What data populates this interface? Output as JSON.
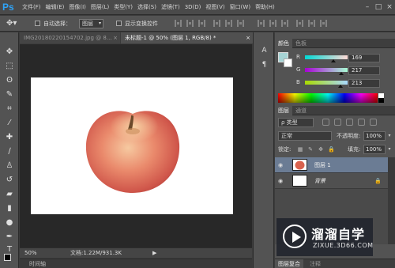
{
  "app": {
    "logo": "Ps"
  },
  "menu": [
    "文件(F)",
    "编辑(E)",
    "图像(I)",
    "图层(L)",
    "类型(Y)",
    "选择(S)",
    "滤镜(T)",
    "3D(D)",
    "视图(V)",
    "窗口(W)",
    "帮助(H)"
  ],
  "window_controls": {
    "minimize": "–",
    "maximize": "□",
    "close": "×"
  },
  "options": {
    "tool_icon": "move-tool",
    "auto_select_label": "自动选择：",
    "auto_select_value": "图层",
    "show_transform_label": "显示变换控件"
  },
  "tabs": [
    {
      "label": "IMG20180220154702.jpg @ 8...",
      "close": "×"
    },
    {
      "label": "未标题-1 @ 50% (图层 1, RGB/8) *",
      "close": "×"
    }
  ],
  "status": {
    "zoom": "50%",
    "doc_info": "文档:1.22M/931.3K",
    "arrow": "▶"
  },
  "timeline_label": "时间轴",
  "panels": {
    "color_tabs": [
      "颜色",
      "色板"
    ],
    "color": {
      "fg": "#a6d4d5",
      "bg": "#ffffff",
      "channels": [
        {
          "label": "R",
          "value": "169",
          "fraction": 0.66
        },
        {
          "label": "G",
          "value": "217",
          "fraction": 0.85
        },
        {
          "label": "B",
          "value": "213",
          "fraction": 0.84
        }
      ]
    },
    "layers_tabs": [
      "图层",
      "通道"
    ],
    "kind_label": "ρ 类型",
    "blend_mode": "正常",
    "opacity_label": "不透明度:",
    "opacity_value": "100%",
    "lock_label": "锁定:",
    "fill_label": "填充:",
    "fill_value": "100%",
    "layers": [
      {
        "name": "图层 1",
        "selected": true
      },
      {
        "name": "背景",
        "locked": true
      }
    ],
    "bottom_tabs": [
      "图层复合",
      "注释"
    ]
  },
  "watermark": {
    "title": "溜溜自学",
    "url": "ZIXUE.3D66.COM"
  }
}
